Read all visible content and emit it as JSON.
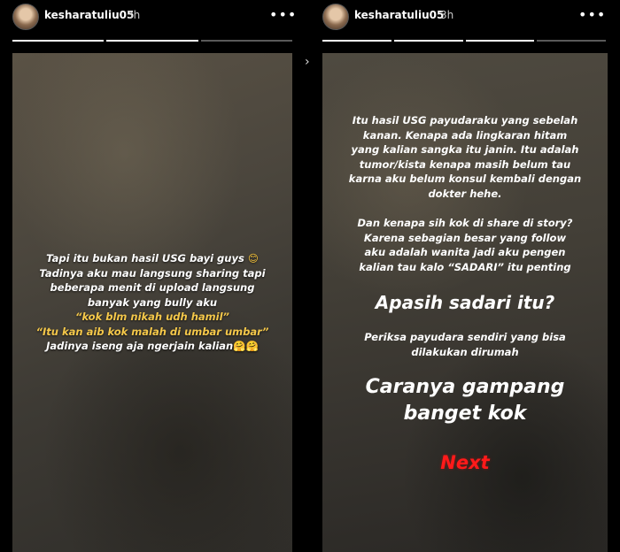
{
  "left_story": {
    "username": "kesharatuliu05",
    "timestamp": "3h",
    "more_icon": "more-options-icon",
    "caption": {
      "line1": "Tapi itu bukan hasil USG bayi guys",
      "line1_emoji": "😊",
      "line2": "Tadinya aku mau langsung sharing tapi",
      "line3": "beberapa menit di upload langsung",
      "line4": "banyak yang bully aku",
      "quote1": "“kok blm nikah udh hamil”",
      "quote2": "“Itu kan aib kok malah di umbar umbar”",
      "line5": "Jadinya iseng aja ngerjain kalian",
      "line5_emoji": "🤗🤗"
    }
  },
  "right_story": {
    "username": "kesharatuliu05",
    "timestamp": "3h",
    "more_icon": "more-options-icon",
    "para1": [
      "Itu hasil USG payudaraku yang sebelah",
      "kanan. Kenapa ada lingkaran hitam",
      "yang kalian sangka itu janin. Itu adalah",
      "tumor/kista kenapa masih belum tau",
      "karna aku belum konsul kembali dengan",
      "dokter hehe."
    ],
    "para2": [
      "Dan kenapa sih kok di share di story?",
      "Karena sebagian besar yang follow",
      "aku adalah wanita jadi aku pengen",
      "kalian tau kalo “SADARI” itu penting"
    ],
    "heading1": "Apasih sadari itu?",
    "para3": [
      "Periksa payudara sendiri yang bisa",
      "dilakukan dirumah"
    ],
    "heading2": [
      "Caranya gampang",
      "banget kok"
    ],
    "next_label": "Next"
  },
  "colors": {
    "highlight_yellow": "#f5c84a",
    "next_red": "#ff1a1a",
    "text_white": "#ffffff"
  }
}
